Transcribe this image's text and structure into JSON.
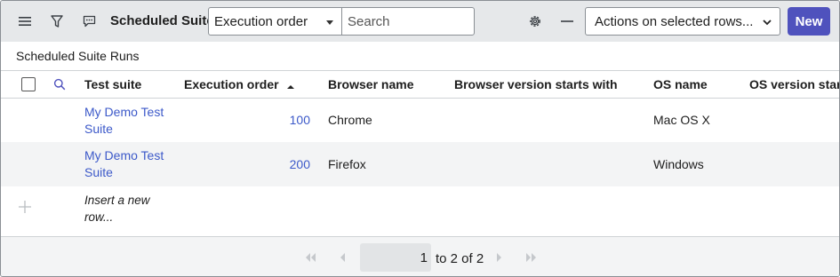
{
  "header": {
    "title": "Scheduled Suites",
    "order_select": {
      "value": "Execution order"
    },
    "search": {
      "placeholder": "Search"
    },
    "actions_select": {
      "value": "Actions on selected rows..."
    },
    "new_label": "New",
    "icons": [
      "menu-icon",
      "filter-icon",
      "comment-icon",
      "gear-icon",
      "minus-icon"
    ]
  },
  "subtitle": "Scheduled Suite Runs",
  "table": {
    "columns": {
      "test_suite": "Test suite",
      "execution_order": "Execution order",
      "browser_name": "Browser name",
      "browser_version": "Browser version starts with",
      "os_name": "OS name",
      "os_version": "OS version starts"
    },
    "sort": {
      "column": "Execution order",
      "direction": "ascending"
    },
    "rows": [
      {
        "test_suite": "My Demo Test Suite",
        "execution_order": "100",
        "browser_name": "Chrome",
        "browser_version": "",
        "os_name": "Mac OS X",
        "os_version": ""
      },
      {
        "test_suite": "My Demo Test Suite",
        "execution_order": "200",
        "browser_name": "Firefox",
        "browser_version": "",
        "os_name": "Windows",
        "os_version": ""
      }
    ],
    "insert_label": "Insert a new row..."
  },
  "pagination": {
    "current": "1",
    "range_text": "to 2 of 2"
  },
  "colors": {
    "header_bg": "#e6e8ea",
    "primary": "#4f52bd",
    "link": "#3c59c9",
    "alt_row": "#f3f4f5"
  }
}
